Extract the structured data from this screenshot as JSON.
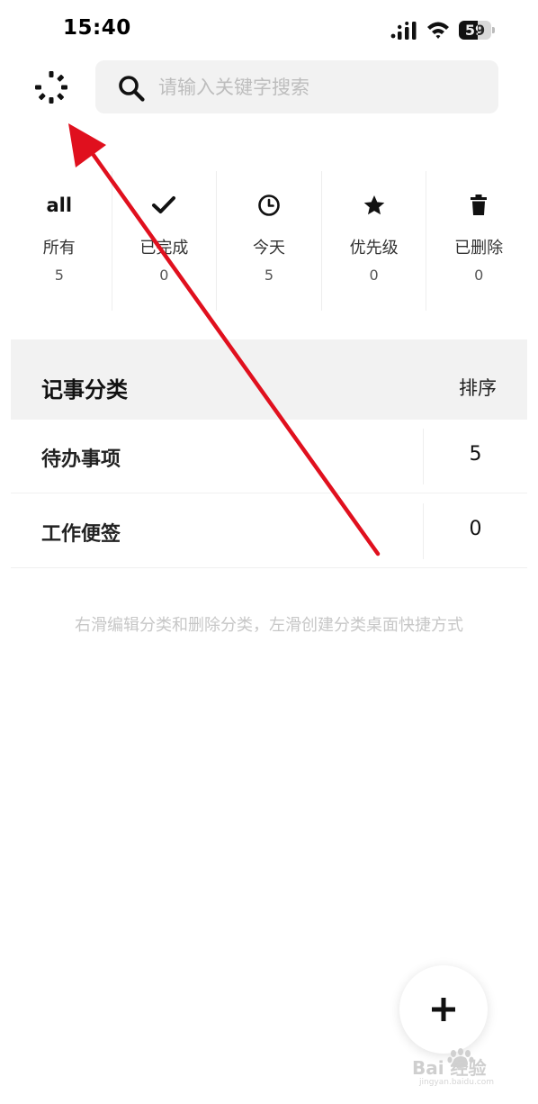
{
  "status_bar": {
    "time": "15:40",
    "battery_percent": 59,
    "battery_text": "59",
    "signal_icon": "cellular-signal-icon",
    "wifi_icon": "wifi-icon"
  },
  "header": {
    "left_icon": "loading-spinner-icon",
    "search": {
      "placeholder": "请输入关键字搜索",
      "value": "",
      "icon": "search-icon"
    }
  },
  "filters": [
    {
      "key": "all",
      "icon": "all",
      "label": "所有",
      "count": "5"
    },
    {
      "key": "completed",
      "icon": "checkmark-icon",
      "label": "已完成",
      "count": "0"
    },
    {
      "key": "today",
      "icon": "clock-icon",
      "label": "今天",
      "count": "5"
    },
    {
      "key": "priority",
      "icon": "star-icon",
      "label": "优先级",
      "count": "0"
    },
    {
      "key": "deleted",
      "icon": "trash-icon",
      "label": "已删除",
      "count": "0"
    }
  ],
  "categories": {
    "title": "记事分类",
    "sort_label": "排序",
    "items": [
      {
        "label": "待办事项",
        "count": "5"
      },
      {
        "label": "工作便签",
        "count": "0"
      }
    ]
  },
  "hint": "右滑编辑分类和删除分类，左滑创建分类桌面快捷方式",
  "fab": {
    "icon": "plus-icon"
  },
  "colors": {
    "accent_arrow": "#e0101e",
    "panel_bg": "#f2f2f2",
    "hint_text": "#c7c7c7"
  },
  "watermark": {
    "text": "Bai 经验",
    "subtext": "jingyan.baidu.com"
  }
}
